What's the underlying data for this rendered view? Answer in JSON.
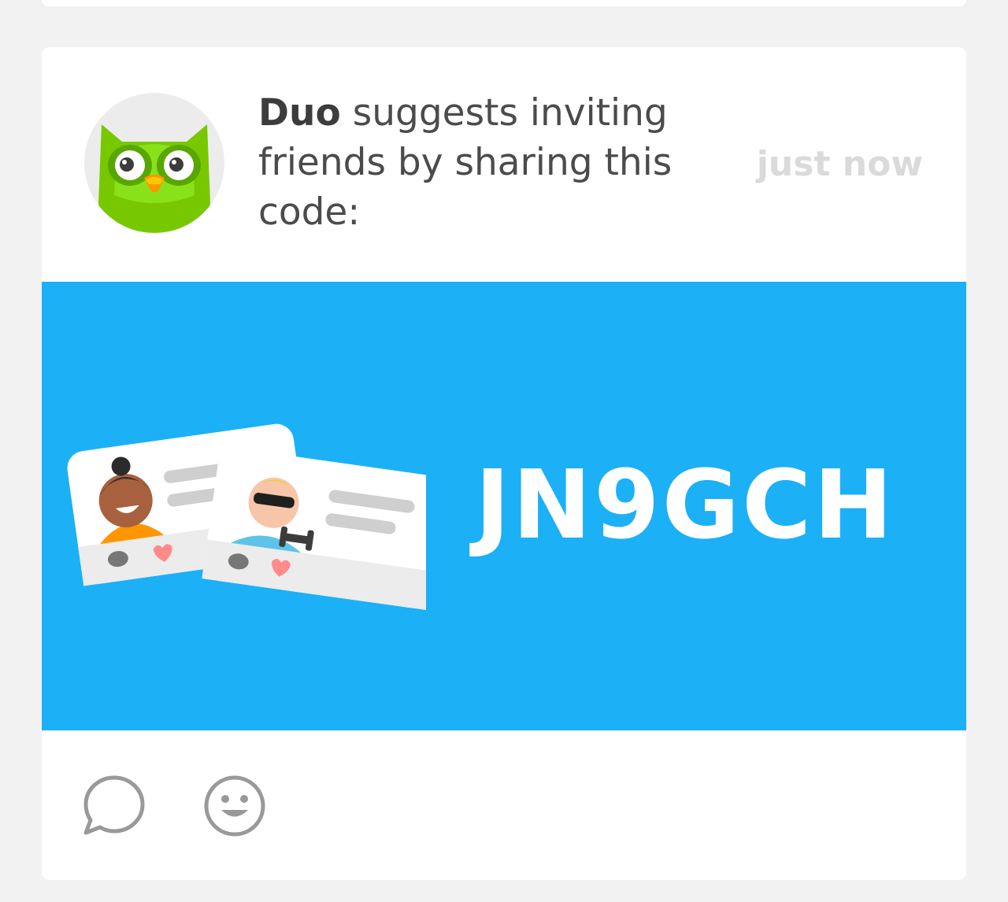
{
  "post": {
    "sender": "Duo",
    "message": " suggests inviting friends by sharing this code:",
    "timestamp": "just now",
    "invite_code": "JN9GCH"
  },
  "colors": {
    "banner": "#1cb0f6",
    "owl_green": "#78c800",
    "icon_gray": "#999999"
  },
  "icons": {
    "avatar": "duo-owl",
    "comment": "speech-bubble-outline",
    "react": "smiley-face-outline"
  }
}
